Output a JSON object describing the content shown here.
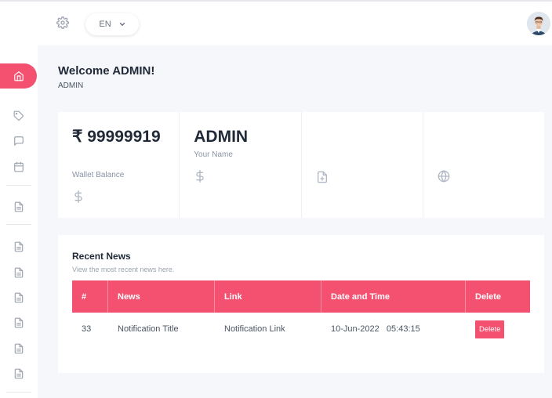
{
  "header": {
    "language": "EN"
  },
  "welcome": {
    "title": "Welcome ADMIN!",
    "subtitle": "ADMIN"
  },
  "stats": [
    {
      "value": "₹ 99999919",
      "label": "Wallet Balance",
      "icon": "dollar-icon"
    },
    {
      "value": "ADMIN",
      "label": "Your Name",
      "icon": "dollar-icon"
    },
    {
      "value": "",
      "label": "",
      "icon": "file-plus-icon"
    },
    {
      "value": "",
      "label": "",
      "icon": "globe-icon"
    }
  ],
  "news": {
    "title": "Recent News",
    "subtitle": "View the most recent news here.",
    "columns": [
      "#",
      "News",
      "Link",
      "Date and Time",
      "Delete"
    ],
    "rows": [
      {
        "id": "33",
        "news": "Notification Title",
        "link": "Notification Link",
        "datetime": "10-Jun-2022   05:43:15",
        "action": "Delete"
      }
    ]
  },
  "sidebar": {
    "items": [
      "home-icon",
      "tag-icon",
      "message-icon",
      "calendar-icon",
      "file-icon",
      "file-icon",
      "file-icon",
      "file-icon",
      "file-icon",
      "file-icon",
      "file-icon"
    ]
  },
  "colors": {
    "accent": "#f4506f",
    "background": "#f6f7fb",
    "card": "#ffffff"
  }
}
